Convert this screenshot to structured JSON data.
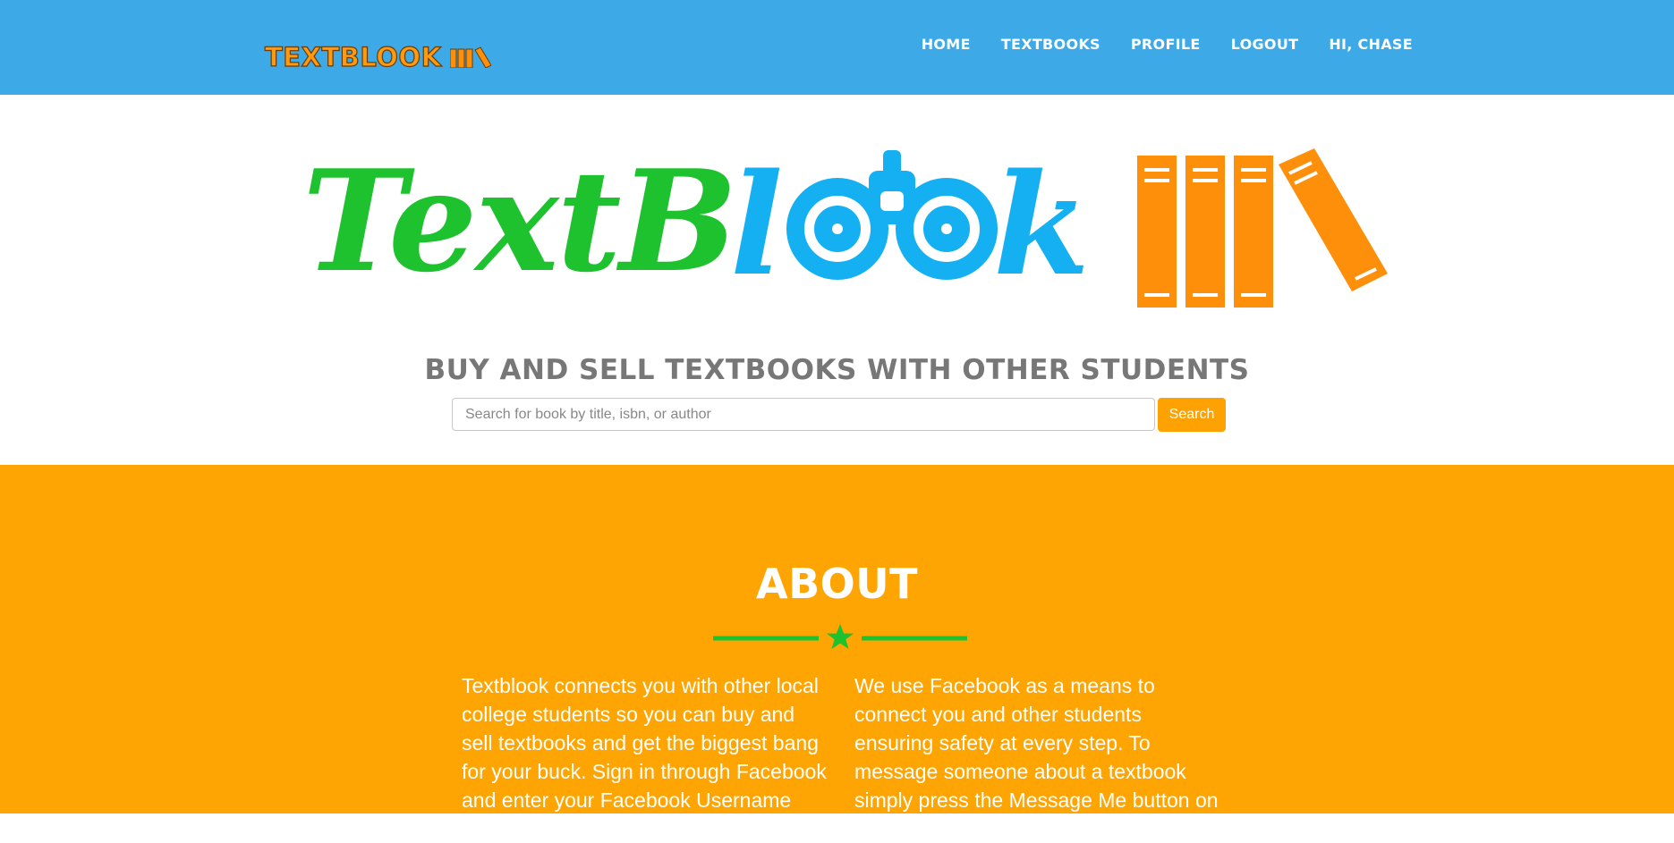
{
  "navbar": {
    "brand": "TEXTBLOOK",
    "links": [
      "HOME",
      "TEXTBOOKS",
      "PROFILE",
      "LOGOUT",
      "HI, CHASE"
    ]
  },
  "hero": {
    "logo_text": "TextBlook",
    "tagline": "BUY AND SELL TEXTBOOKS WITH OTHER STUDENTS",
    "search": {
      "placeholder": "Search for book by title, isbn, or author",
      "value": "",
      "button_label": "Search"
    }
  },
  "about": {
    "title": "ABOUT",
    "left_text": "Textblook connects you with other local college students so you can buy and sell textbooks and get the biggest bang for your buck. Sign in through Facebook and enter your Facebook Username and your",
    "right_text": "We use Facebook as a means to connect you and other students ensuring safety at every step. To message someone about a textbook simply press the Message Me button on the page of the book you want."
  },
  "colors": {
    "navbar": "#3da9e6",
    "accent_orange": "#fea504",
    "logo_green": "#1ec22f",
    "logo_blue": "#14b0f2",
    "book_orange": "#fe8f0a"
  }
}
